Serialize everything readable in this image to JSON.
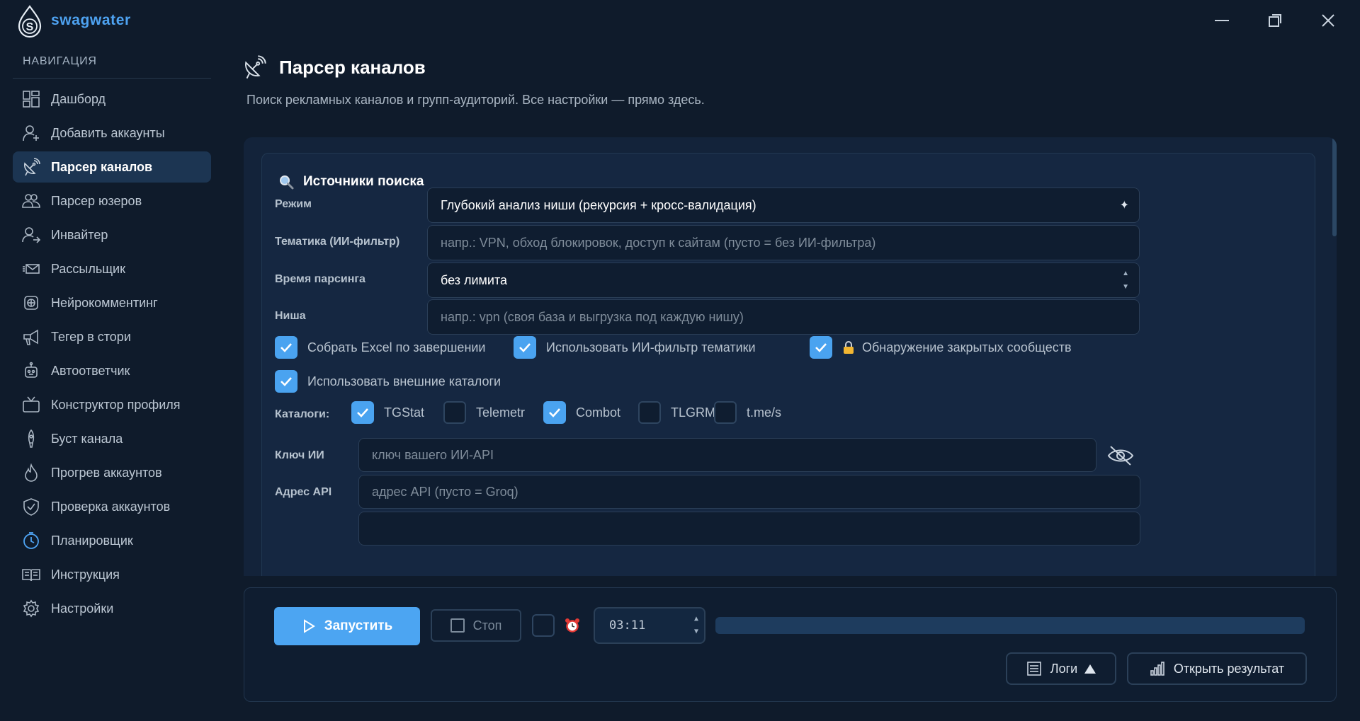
{
  "app": {
    "name": "swagwater"
  },
  "sidebar": {
    "title": "НАВИГАЦИЯ",
    "items": [
      {
        "label": "Дашборд",
        "icon": "dashboard-icon"
      },
      {
        "label": "Добавить аккаунты",
        "icon": "add-user-icon"
      },
      {
        "label": "Парсер каналов",
        "icon": "satellite-icon",
        "active": true
      },
      {
        "label": "Парсер юзеров",
        "icon": "users-icon"
      },
      {
        "label": "Инвайтер",
        "icon": "invite-icon"
      },
      {
        "label": "Рассыльщик",
        "icon": "envelope-icon"
      },
      {
        "label": "Нейрокомментинг",
        "icon": "chip-icon"
      },
      {
        "label": "Тегер в стори",
        "icon": "megaphone-icon"
      },
      {
        "label": "Автоответчик",
        "icon": "robot-icon"
      },
      {
        "label": "Конструктор профиля",
        "icon": "tv-icon"
      },
      {
        "label": "Буст канала",
        "icon": "rocket-icon"
      },
      {
        "label": "Прогрев аккаунтов",
        "icon": "flame-icon"
      },
      {
        "label": "Проверка аккаунтов",
        "icon": "shield-check-icon"
      },
      {
        "label": "Планировщик",
        "icon": "clock-icon"
      },
      {
        "label": "Инструкция",
        "icon": "book-icon"
      },
      {
        "label": "Настройки",
        "icon": "gear-icon"
      }
    ]
  },
  "header": {
    "title": "Парсер каналов",
    "subtitle": "Поиск рекламных каналов и групп-аудиторий. Все настройки — прямо здесь."
  },
  "sources": {
    "title": "Источники поиска",
    "mode": {
      "label": "Режим",
      "value": "Глубокий анализ ниши (рекурсия + кросс-валидация)"
    },
    "topic": {
      "label": "Тематика (ИИ-фильтр)",
      "placeholder": "напр.: VPN, обход блокировок, доступ к сайтам (пусто = без ИИ-фильтра)"
    },
    "time": {
      "label": "Время парсинга",
      "value": "без лимита"
    },
    "niche": {
      "label": "Ниша",
      "placeholder": "напр.: vpn  (своя база и выгрузка под каждую нишу)"
    },
    "options": [
      {
        "label": "Собрать Excel по завершении",
        "checked": true
      },
      {
        "label": "Использовать ИИ-фильтр тематики",
        "checked": true
      },
      {
        "label": "Обнаружение закрытых сообществ",
        "checked": true,
        "locked": true
      },
      {
        "label": "Использовать внешние каталоги",
        "checked": true
      }
    ],
    "catalogs": {
      "label": "Каталоги:",
      "items": [
        {
          "label": "TGStat",
          "checked": true
        },
        {
          "label": "Telemetr",
          "checked": false
        },
        {
          "label": "Combot",
          "checked": true
        },
        {
          "label": "TLGRM",
          "checked": false
        },
        {
          "label": "t.me/s",
          "checked": false
        }
      ]
    },
    "ai_key": {
      "label": "Ключ ИИ",
      "placeholder": "ключ вашего ИИ-API"
    },
    "api_address": {
      "label": "Адрес API",
      "placeholder": "адрес API (пусто = Groq)"
    }
  },
  "controls": {
    "run_label": "Запустить",
    "stop_label": "Стоп",
    "timer_value": "03:11",
    "timer_enabled": false,
    "progress": 0,
    "logs_label": "Логи",
    "open_result_label": "Открыть результат"
  },
  "colors": {
    "background": "#0f1b2b",
    "accent": "#4ca5f2",
    "active_nav": "#1c3552"
  }
}
